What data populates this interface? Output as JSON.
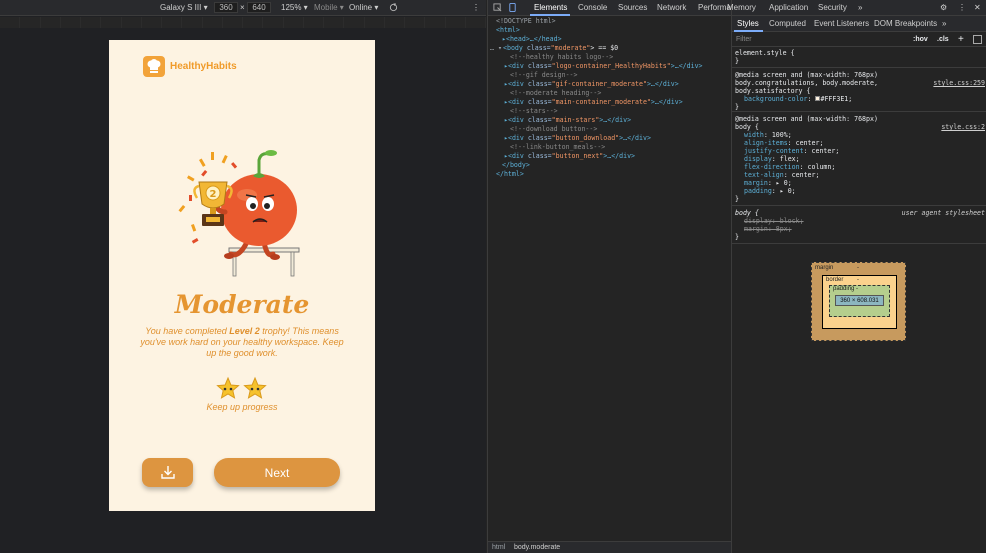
{
  "device_toolbar": {
    "device": "Galaxy S III ▾",
    "width": "360",
    "height": "640",
    "times": "×",
    "zoom": "125% ▾",
    "mode": "Mobile ▾",
    "network": "Online ▾"
  },
  "app": {
    "logo_text": "HealthyHabits",
    "heading": "Moderate",
    "message_part1": "You have completed ",
    "message_bold": "Level 2",
    "message_part2": " trophy! This means you've work hard on your healthy workspace. Keep up the good work.",
    "trophy_level": "2",
    "stars_earned": 2,
    "progress_text": "Keep up progress",
    "next_label": "Next"
  },
  "devtools_tabs": [
    "Elements",
    "Console",
    "Sources",
    "Network",
    "Performance",
    "Memory",
    "Application",
    "Security",
    "»"
  ],
  "dom": {
    "l1": "<!DOCTYPE html>",
    "l2": "<html>",
    "l3": "▸<head>…</head>",
    "l4_prefix": "… ▾",
    "l4_tag": "<body ",
    "l4_attr": "class=",
    "l4_val": "\"moderate\"",
    "l4_end": "> == $0",
    "c1": "<!--healthy habits logo-->",
    "d1_cls": "\"logo-container_HealthyHabits\"",
    "c2": "<!--gif design-->",
    "d2_cls": "\"gif-container_moderate\"",
    "c3": "<!--moderate heading-->",
    "d3_cls": "\"main-container_moderate\"",
    "c4": "<!--stars-->",
    "d4_cls": "\"main-stars\"",
    "c5": "<!--download button-->",
    "d5_cls": "\"button_download\"",
    "c6": "<!--link-button_meals-->",
    "d6_cls": "\"button_next\"",
    "div_open": "▸<div ",
    "div_attr": "class=",
    "div_close": ">…</div>",
    "body_close": "</body>",
    "html_close": "</html>"
  },
  "breadcrumb": {
    "html": "html",
    "body": "body.moderate"
  },
  "styles_tabs": [
    "Styles",
    "Computed",
    "Event Listeners",
    "DOM Breakpoints",
    "»"
  ],
  "filter": {
    "placeholder": "Filter",
    "hov": ":hov",
    "cls": ".cls",
    "plus": "+"
  },
  "rules": {
    "r0_sel": "element.style {",
    "close": "}",
    "r1_media": "@media screen and (max-width: 768px)",
    "r1_sel1": "body.congratulations, body.moderate,",
    "r1_sel2": "body.satisfactory {",
    "r1_src": "style.css:259",
    "r1_prop": "background-color",
    "r1_val": "#FFF3E1;",
    "r2_media": "@media screen and (max-width: 768px)",
    "r2_sel": "body {",
    "r2_src": "style.css:2",
    "r2_props": [
      {
        "n": "width",
        "v": "100%;"
      },
      {
        "n": "align-items",
        "v": "center;"
      },
      {
        "n": "justify-content",
        "v": "center;"
      },
      {
        "n": "display",
        "v": "flex;"
      },
      {
        "n": "flex-direction",
        "v": "column;"
      },
      {
        "n": "text-align",
        "v": "center;"
      },
      {
        "n": "margin",
        "v": "▸ 0;"
      },
      {
        "n": "padding",
        "v": "▸ 0;"
      }
    ],
    "r3_sel": "body {",
    "r3_src": "user agent stylesheet",
    "r3_p1": "display: block;",
    "r3_p2": "margin: 8px;"
  },
  "box_model": {
    "margin": "margin",
    "border": "border",
    "padding": "padding -",
    "content": "360 × 608.031",
    "dash": "-"
  },
  "colors": {
    "accent": "#dd9540",
    "page_bg": "#fdf3e2",
    "heading": "#e59531",
    "bg_swatch": "#FFF3E1"
  }
}
